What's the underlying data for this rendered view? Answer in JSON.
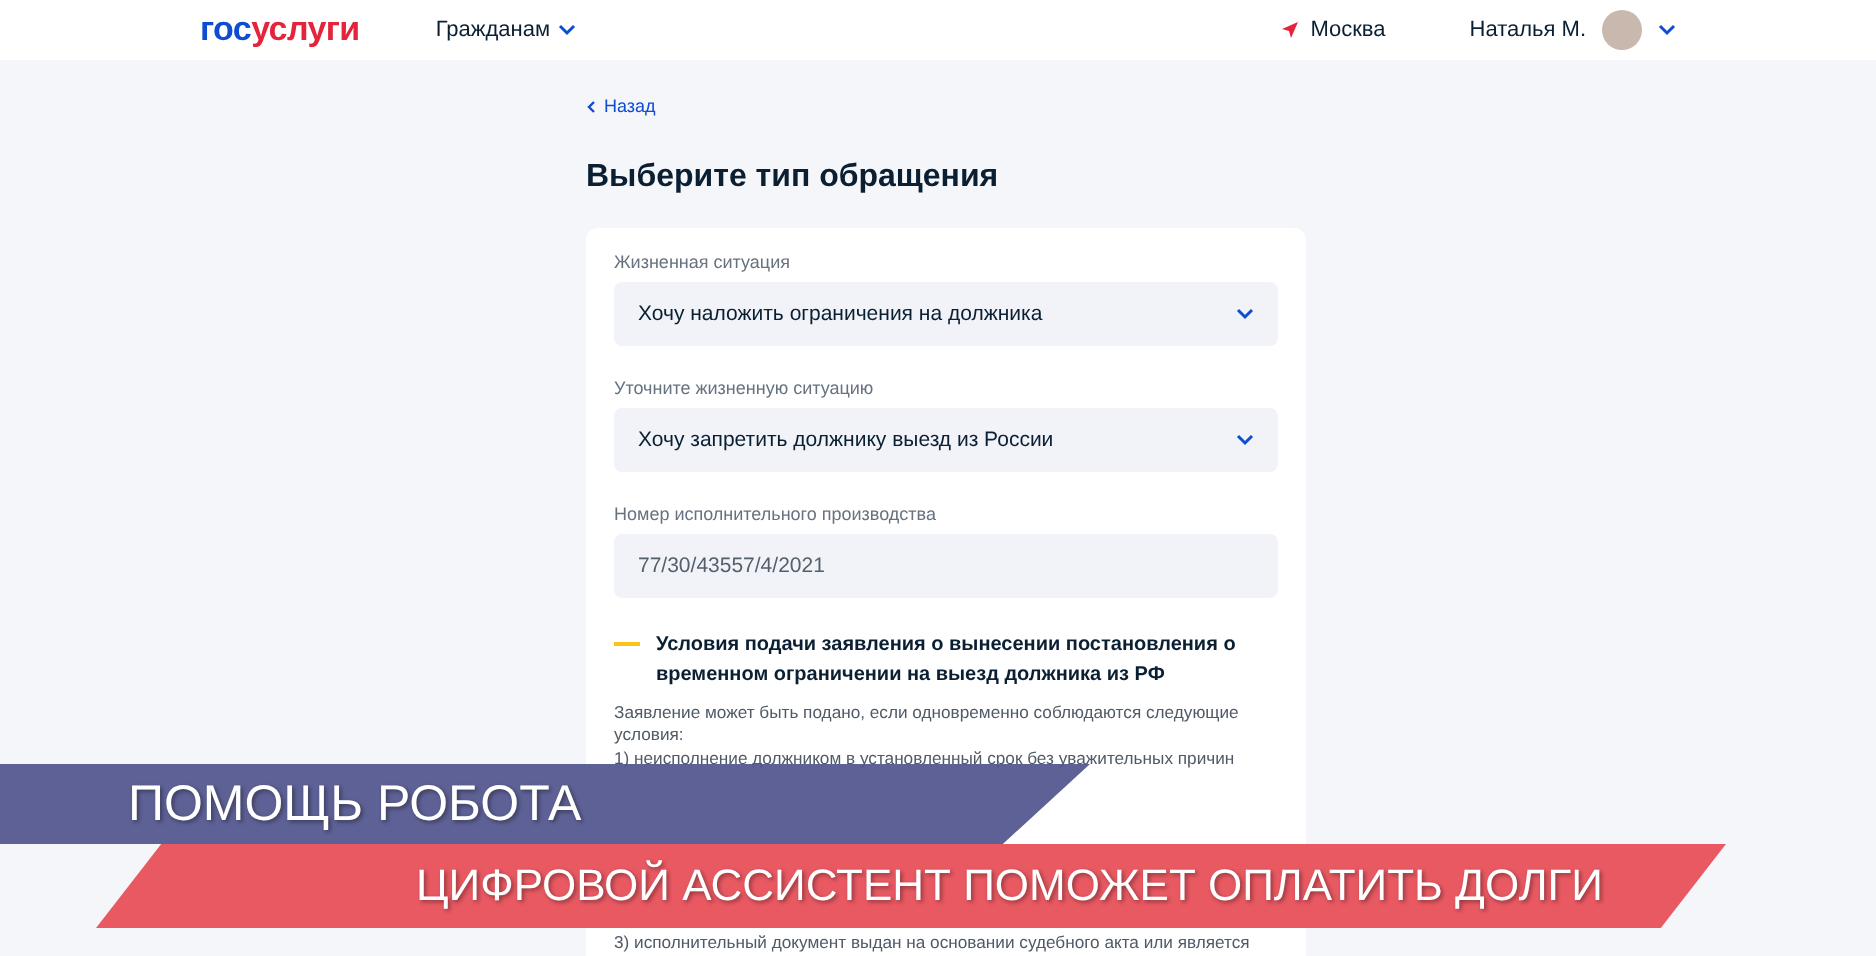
{
  "header": {
    "logo": {
      "first": "гос",
      "second": "услуги"
    },
    "nav_menu": "Гражданам",
    "location": "Москва",
    "user": "Наталья М."
  },
  "back_link": "Назад",
  "title": "Выберите тип обращения",
  "fields": [
    {
      "kind": "select",
      "label": "Жизненная ситуация",
      "value": "Хочу наложить ограничения на должника"
    },
    {
      "kind": "select",
      "label": "Уточните жизненную ситуацию",
      "value": "Хочу запретить должнику выезд из России"
    },
    {
      "kind": "input",
      "label": "Номер исполнительного производства",
      "value": "77/30/43557/4/2021"
    }
  ],
  "conditions": {
    "title": "Условия подачи заявления о вынесении постановления о временном ограничении на выезд должника из РФ",
    "paragraphs": [
      {
        "kind": "text",
        "text": "Заявление может быть подано, если одновременно соблюдаются следующие условия:"
      },
      {
        "kind": "text",
        "text": "1) неисполнение должником в установленный срок без уважительных причин"
      },
      {
        "kind": "hidden"
      },
      {
        "kind": "text",
        "text": "3) исполнительный документ выдан на основании судебного акта или является"
      }
    ]
  },
  "overlays": [
    {
      "kind": "topic",
      "text": "ПОМОЩЬ РОБОТА"
    },
    {
      "kind": "headline",
      "text": "ЦИФРОВОЙ АССИСТЕНТ ПОМОЖЕТ ОПЛАТИТЬ ДОЛГИ"
    }
  ]
}
